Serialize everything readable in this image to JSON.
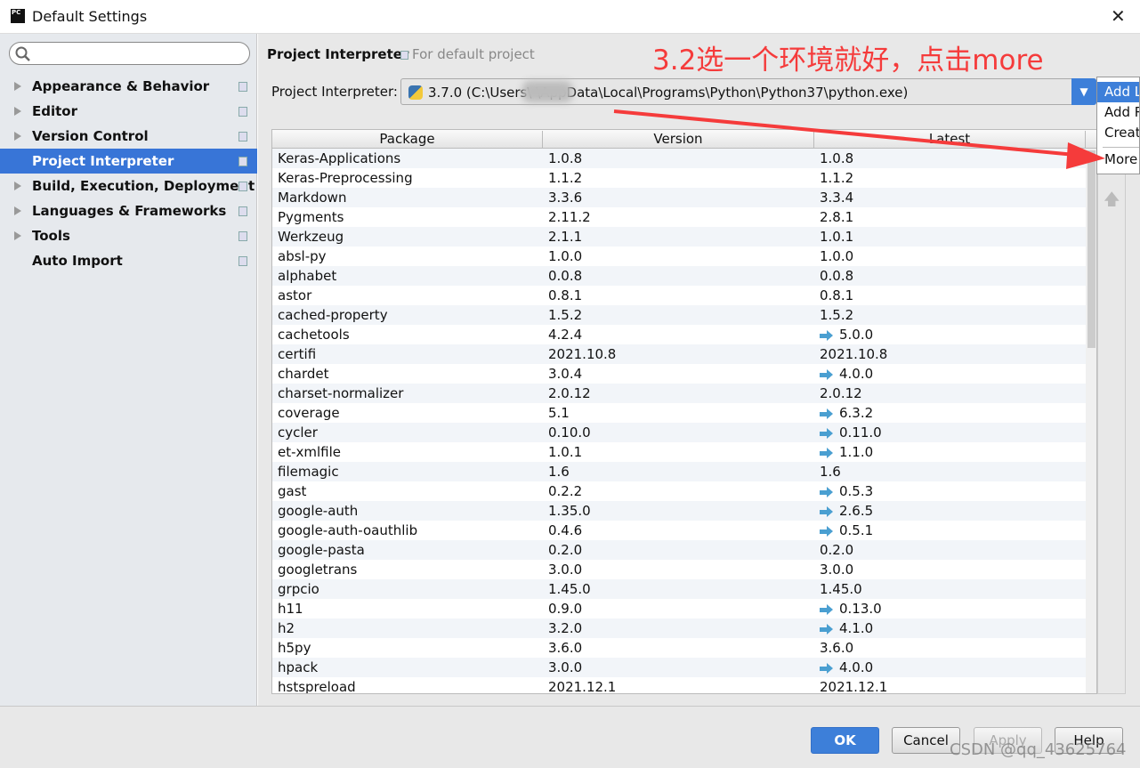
{
  "window": {
    "title": "Default Settings",
    "logo": "PC"
  },
  "sidebar": {
    "search_placeholder": "",
    "items": [
      {
        "label": "Appearance & Behavior",
        "expandable": true
      },
      {
        "label": "Editor",
        "expandable": true
      },
      {
        "label": "Version Control",
        "expandable": true
      },
      {
        "label": "Project Interpreter",
        "expandable": false,
        "selected": true
      },
      {
        "label": "Build, Execution, Deployment",
        "expandable": true
      },
      {
        "label": "Languages & Frameworks",
        "expandable": true
      },
      {
        "label": "Tools",
        "expandable": true
      },
      {
        "label": "Auto Import",
        "expandable": false
      }
    ]
  },
  "main": {
    "title": "Project Interpreter",
    "subtitle": "For default project",
    "interpreter_label": "Project Interpreter:",
    "interpreter_value": "3.7.0 (C:\\Users\\         \\AppData\\Local\\Programs\\Python\\Python37\\python.exe)"
  },
  "table": {
    "columns": [
      "Package",
      "Version",
      "Latest"
    ],
    "rows": [
      [
        "Keras-Applications",
        "1.0.8",
        "1.0.8",
        false
      ],
      [
        "Keras-Preprocessing",
        "1.1.2",
        "1.1.2",
        false
      ],
      [
        "Markdown",
        "3.3.6",
        "3.3.4",
        false
      ],
      [
        "Pygments",
        "2.11.2",
        "2.8.1",
        false
      ],
      [
        "Werkzeug",
        "2.1.1",
        "1.0.1",
        false
      ],
      [
        "absl-py",
        "1.0.0",
        "1.0.0",
        false
      ],
      [
        "alphabet",
        "0.0.8",
        "0.0.8",
        false
      ],
      [
        "astor",
        "0.8.1",
        "0.8.1",
        false
      ],
      [
        "cached-property",
        "1.5.2",
        "1.5.2",
        false
      ],
      [
        "cachetools",
        "4.2.4",
        "5.0.0",
        true
      ],
      [
        "certifi",
        "2021.10.8",
        "2021.10.8",
        false
      ],
      [
        "chardet",
        "3.0.4",
        "4.0.0",
        true
      ],
      [
        "charset-normalizer",
        "2.0.12",
        "2.0.12",
        false
      ],
      [
        "coverage",
        "5.1",
        "6.3.2",
        true
      ],
      [
        "cycler",
        "0.10.0",
        "0.11.0",
        true
      ],
      [
        "et-xmlfile",
        "1.0.1",
        "1.1.0",
        true
      ],
      [
        "filemagic",
        "1.6",
        "1.6",
        false
      ],
      [
        "gast",
        "0.2.2",
        "0.5.3",
        true
      ],
      [
        "google-auth",
        "1.35.0",
        "2.6.5",
        true
      ],
      [
        "google-auth-oauthlib",
        "0.4.6",
        "0.5.1",
        true
      ],
      [
        "google-pasta",
        "0.2.0",
        "0.2.0",
        false
      ],
      [
        "googletrans",
        "3.0.0",
        "3.0.0",
        false
      ],
      [
        "grpcio",
        "1.45.0",
        "1.45.0",
        false
      ],
      [
        "h11",
        "0.9.0",
        "0.13.0",
        true
      ],
      [
        "h2",
        "3.2.0",
        "4.1.0",
        true
      ],
      [
        "h5py",
        "3.6.0",
        "3.6.0",
        false
      ],
      [
        "hpack",
        "3.0.0",
        "4.0.0",
        true
      ],
      [
        "hstspreload",
        "2021.12.1",
        "2021.12.1",
        false
      ]
    ]
  },
  "popup": {
    "items": [
      "Add L",
      "Add R",
      "Creat",
      "More"
    ]
  },
  "footer": {
    "ok": "OK",
    "cancel": "Cancel",
    "apply": "Apply",
    "help": "Help"
  },
  "annotation": "3.2选一个环境就好，点击more",
  "watermark": "CSDN @qq_43625764",
  "colors": {
    "accent": "#3875d7",
    "annotation": "#f53b3b",
    "upgrade_arrow": "#4a9fd1"
  }
}
